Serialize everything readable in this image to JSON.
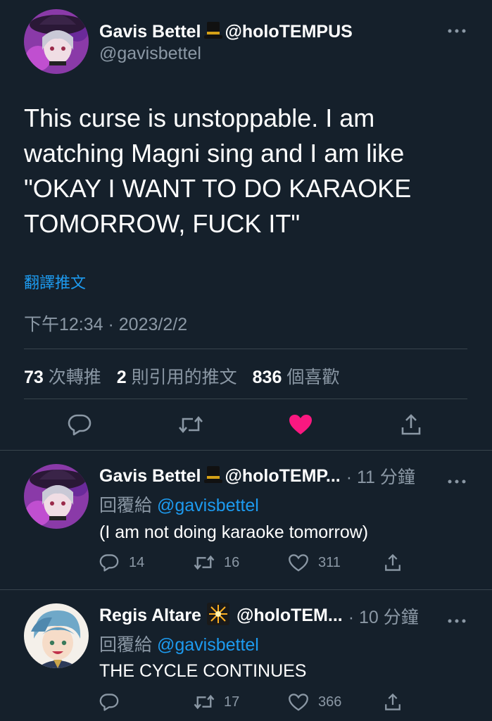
{
  "main_tweet": {
    "display_name": "Gavis Bettel",
    "name_emoji": "top-hat",
    "name_suffix": "@holoTEMPUS",
    "handle": "@gavisbettel",
    "text_lines": [
      "This curse is unstoppable. I am",
      "watching Magni sing and I am like",
      "\"OKAY I WANT TO DO KARAOKE",
      "TOMORROW, FUCK IT\""
    ],
    "translate_label": "翻譯推文",
    "timestamp": "下午12:34 · 2023/2/2",
    "stats": {
      "retweets_count": "73",
      "retweets_label": "次轉推",
      "quotes_count": "2",
      "quotes_label": "則引用的推文",
      "likes_count": "836",
      "likes_label": "個喜歡"
    },
    "liked": true,
    "accent_color": "#f91880"
  },
  "replies": [
    {
      "display_name": "Gavis Bettel",
      "name_emoji": "top-hat",
      "name_suffix": "@holoTEMP...",
      "time": "· 11 分鐘",
      "replying_to_label": "回覆給",
      "replying_to_handle": "@gavisbettel",
      "text": "(I am not doing karaoke tomorrow)",
      "reply_count": "14",
      "retweet_count": "16",
      "like_count": "311"
    },
    {
      "display_name": "Regis Altare",
      "name_emoji": "sparkler",
      "name_suffix": "@holoTEM...",
      "time": "· 10 分鐘",
      "replying_to_label": "回覆給",
      "replying_to_handle": "@gavisbettel",
      "text": "THE CYCLE CONTINUES",
      "reply_count": "",
      "retweet_count": "17",
      "like_count": "366"
    }
  ],
  "colors": {
    "background": "#15202b",
    "text": "#ffffff",
    "muted": "#8b98a5",
    "link": "#1d9bf0",
    "like": "#f91880",
    "divider": "#38444d"
  }
}
